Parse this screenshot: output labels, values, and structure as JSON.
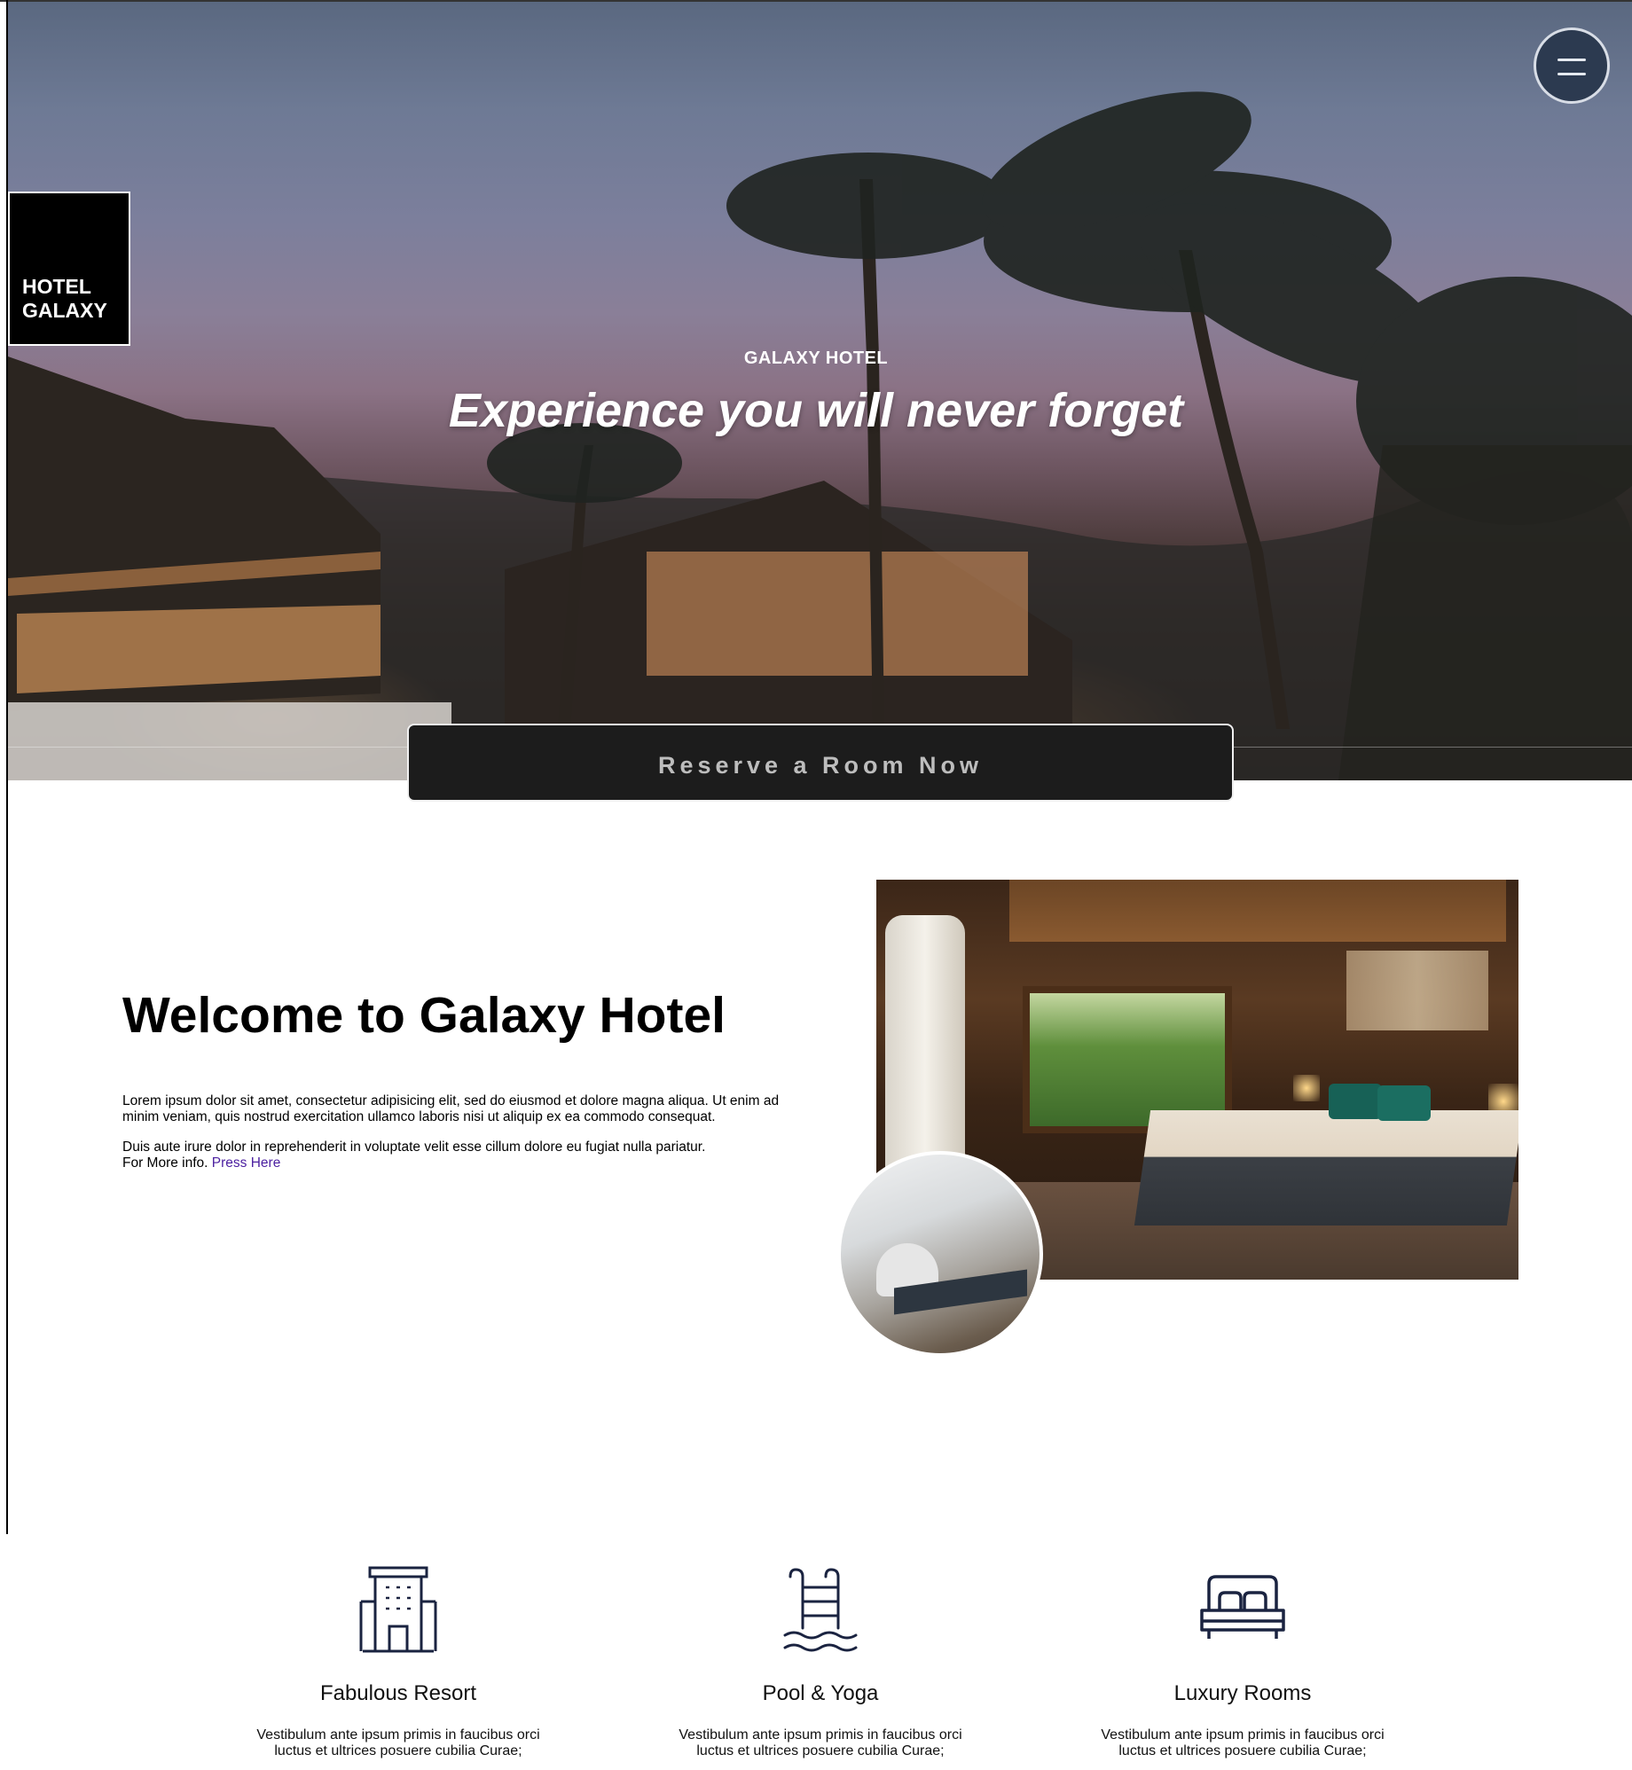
{
  "brand": {
    "name": "HOTEL\nGALAXY"
  },
  "menu": {
    "icon": "menu-icon"
  },
  "hero": {
    "kicker": "GALAXY HOTEL",
    "title": "Experience you will never forget",
    "cta_label": "Reserve a Room Now"
  },
  "welcome": {
    "title": "Welcome to Galaxy Hotel",
    "paragraph1": "Lorem ipsum dolor sit amet, consectetur adipisicing elit, sed do eiusmod et dolore magna aliqua. Ut enim ad minim veniam, quis nostrud exercitation ullamco laboris nisi ut aliquip ex ea commodo consequat.",
    "paragraph2": "Duis aute irure dolor in reprehenderit in voluptate velit esse cillum dolore eu fugiat nulla pariatur.",
    "more_prefix": "For More info.",
    "more_link": "Press Here"
  },
  "colors": {
    "link": "#4b1fa0",
    "icon_stroke": "#1a2340",
    "menu_bg": "#2c3a50"
  },
  "features": [
    {
      "icon": "building-icon",
      "title": "Fabulous Resort",
      "text": "Vestibulum ante ipsum primis in faucibus orci luctus et ultrices posuere cubilia Curae;"
    },
    {
      "icon": "pool-ladder-icon",
      "title": "Pool & Yoga",
      "text": "Vestibulum ante ipsum primis in faucibus orci luctus et ultrices posuere cubilia Curae;"
    },
    {
      "icon": "bed-icon",
      "title": "Luxury Rooms",
      "text": "Vestibulum ante ipsum primis in faucibus orci luctus et ultrices posuere cubilia Curae;"
    }
  ]
}
